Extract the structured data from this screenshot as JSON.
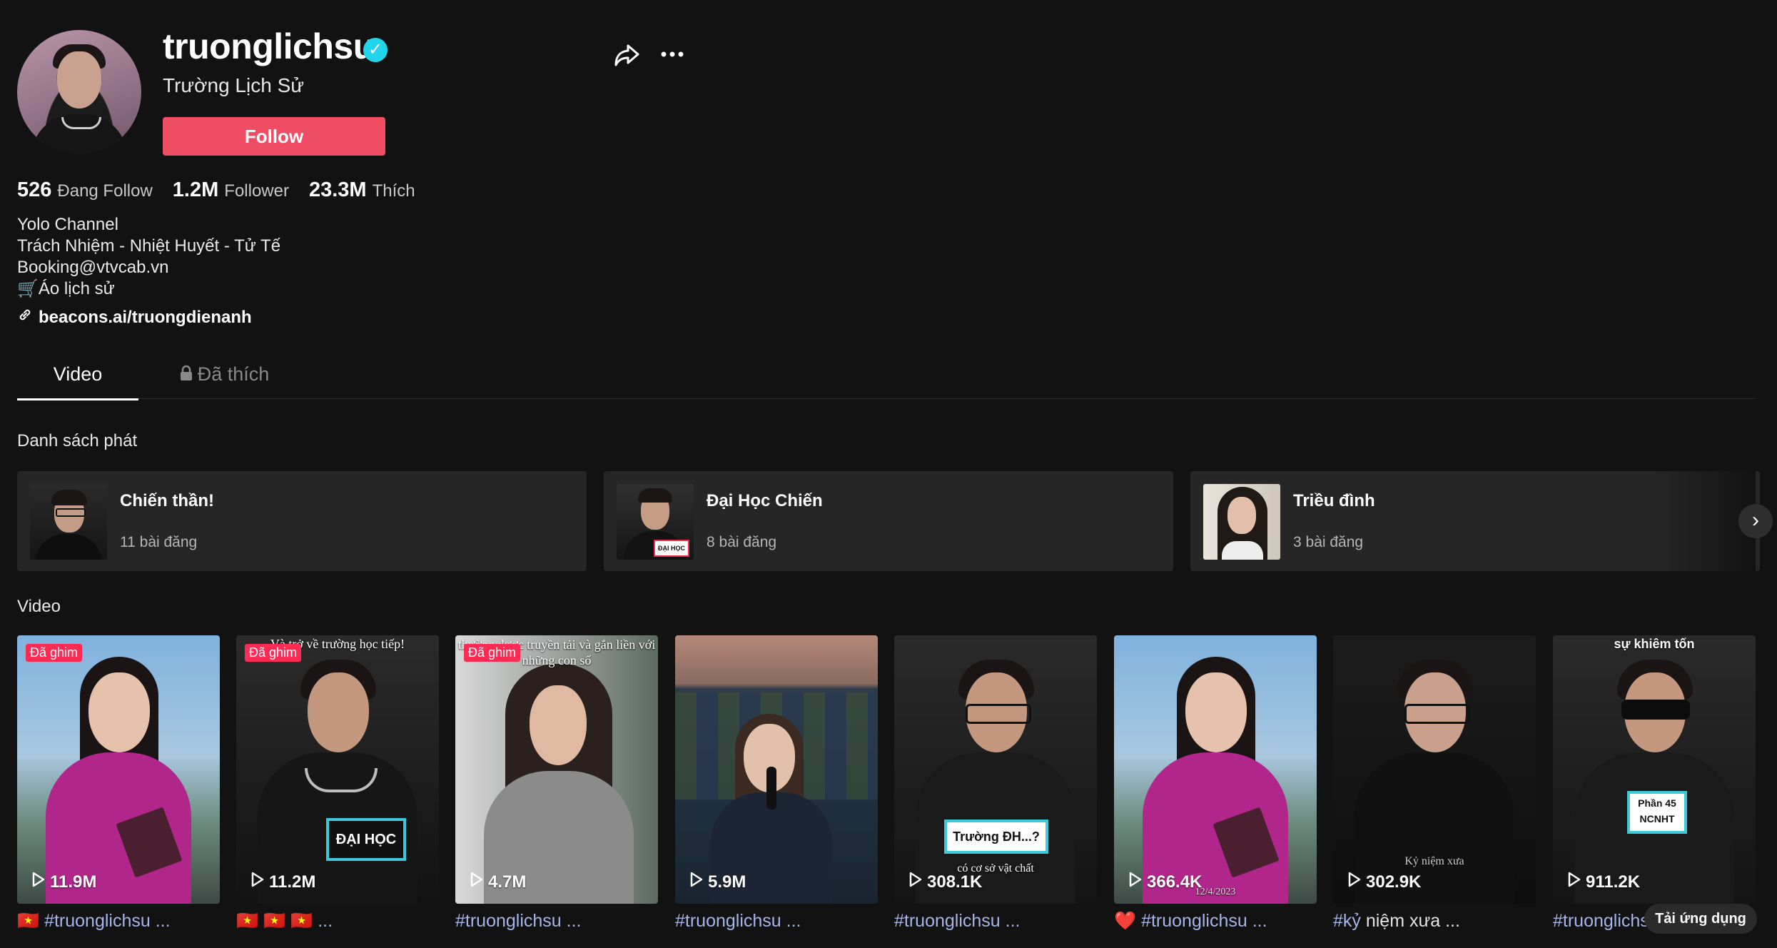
{
  "profile": {
    "username": "truonglichsu",
    "nickname": "Trường Lịch Sử",
    "follow_label": "Follow",
    "verified_glyph": "✓",
    "stats": [
      {
        "value": "526",
        "label": "Đang Follow"
      },
      {
        "value": "1.2M",
        "label": "Follower"
      },
      {
        "value": "23.3M",
        "label": "Thích"
      }
    ],
    "bio": [
      "Yolo Channel",
      "Trách Nhiệm - Nhiệt Huyết - Tử Tế",
      "Booking@vtvcab.vn",
      "🛒Áo lịch sử"
    ],
    "link": "beacons.ai/truongdienanh"
  },
  "tabs": {
    "video": "Video",
    "liked": "Đã thích"
  },
  "playlists": {
    "title": "Danh sách phát",
    "items": [
      {
        "title": "Chiến thần!",
        "count": "11 bài đăng"
      },
      {
        "title": "Đại Học Chiến",
        "count": "8 bài đăng",
        "thumb_badge": "ĐẠI HỌC"
      },
      {
        "title": "Triều đình",
        "count": "3 bài đăng"
      }
    ]
  },
  "videos": {
    "title": "Video",
    "pinned_label": "Đã ghim",
    "items": [
      {
        "views": "11.9M",
        "caption_prefix": "🇻🇳 ",
        "caption": "#truonglichsu ...",
        "pinned": true
      },
      {
        "views": "11.2M",
        "caption_prefix": "🇻🇳 🇻🇳 🇻🇳 ",
        "caption": "...",
        "pinned": true,
        "overlay": "Và trở về trường học tiếp!",
        "badge": "ĐẠI HỌC"
      },
      {
        "views": "4.7M",
        "caption_prefix": "",
        "caption": "#truonglichsu ...",
        "pinned": true,
        "overlay": "thường được truyền tải và gắn liền với những con số"
      },
      {
        "views": "5.9M",
        "caption_prefix": "",
        "caption": "#truonglichsu ...",
        "pinned": false
      },
      {
        "views": "308.1K",
        "caption_prefix": "",
        "caption": "#truonglichsu ...",
        "pinned": false,
        "badge": "Trường ĐH...?",
        "overlay_bottom": "có cơ sở vật chất"
      },
      {
        "views": "366.4K",
        "caption_prefix": "❤️ ",
        "caption": "#truonglichsu ...",
        "pinned": false,
        "overlay_bottom": "12/4/2023"
      },
      {
        "views": "302.9K",
        "caption_prefix": "",
        "caption_tag": "#kỷ",
        "caption": " niệm xưa ...",
        "pinned": false,
        "overlay_bottom": "Kỷ niệm xưa"
      },
      {
        "views": "911.2K",
        "caption_prefix": "",
        "caption": "#truonglichsu ...",
        "pinned": false,
        "overlay": "sự khiêm tốn",
        "badge": "Phần 45 NCNHT"
      }
    ]
  },
  "download_label": "Tải ứng dụng",
  "colors": {
    "background": "#121212",
    "follow": "#ee4d63",
    "pinned": "#fe2c55",
    "verified": "#20d5ec",
    "card": "#262626"
  }
}
